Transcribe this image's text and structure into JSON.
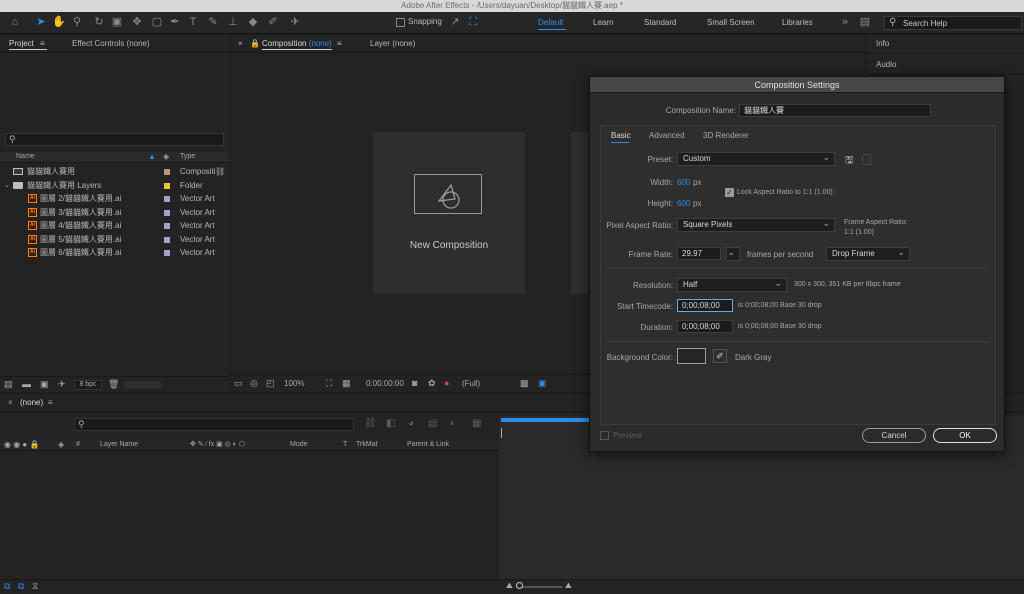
{
  "window": {
    "title": "Adobe After Effects - /Users/dayuan/Desktop/貓貓鐵人賽.aep *"
  },
  "toolbar": {
    "snapping_label": "Snapping",
    "workspaces": [
      "Default",
      "Learn",
      "Standard",
      "Small Screen",
      "Libraries"
    ],
    "active_workspace": "Default",
    "search_placeholder": "Search Help"
  },
  "project_panel": {
    "tabs": [
      "Project",
      "Effect Controls (none)"
    ],
    "columns": {
      "name": "Name",
      "type": "Type"
    },
    "items": [
      {
        "name": "貓貓鐵人賽用",
        "type": "Compositi",
        "icon": "composition-icon",
        "color": "#b89b75",
        "indent": 0
      },
      {
        "name": "貓貓鐵人賽用 Layers",
        "type": "Folder",
        "icon": "folder-icon",
        "color": "#e6c629",
        "indent": 0
      },
      {
        "name": "圖層 2/貓貓鐵人賽用.ai",
        "type": "Vector Art",
        "icon": "ai-file-icon",
        "color": "#a59fd3",
        "indent": 1
      },
      {
        "name": "圖層 3/貓貓鐵人賽用.ai",
        "type": "Vector Art",
        "icon": "ai-file-icon",
        "color": "#a59fd3",
        "indent": 1
      },
      {
        "name": "圖層 4/貓貓鐵人賽用.ai",
        "type": "Vector Art",
        "icon": "ai-file-icon",
        "color": "#a59fd3",
        "indent": 1
      },
      {
        "name": "圖層 5/貓貓鐵人賽用.ai",
        "type": "Vector Art",
        "icon": "ai-file-icon",
        "color": "#a59fd3",
        "indent": 1
      },
      {
        "name": "圖層 6/貓貓鐵人賽用.ai",
        "type": "Vector Art",
        "icon": "ai-file-icon",
        "color": "#a59fd3",
        "indent": 1
      }
    ],
    "bpc_label": "8 bpc"
  },
  "comp_panel": {
    "tab_label": "Composition",
    "tab_value": "(none)",
    "layer_tab": "Layer (none)",
    "new_comp_label": "New Composition",
    "zoom": "100%",
    "timecode": "0:00:00:00",
    "resolution": "(Full)"
  },
  "right_panels": [
    "Info",
    "Audio"
  ],
  "timeline": {
    "tab_label": "(none)",
    "columns": [
      "Layer Name",
      "Mode",
      "T",
      "TrkMat",
      "Parent & Link"
    ]
  },
  "dialog": {
    "title": "Composition Settings",
    "comp_name_label": "Composition Name:",
    "comp_name": "貓貓鐵人賽",
    "tabs": [
      "Basic",
      "Advanced",
      "3D Renderer"
    ],
    "preset_label": "Preset:",
    "preset": "Custom",
    "width_label": "Width:",
    "width": "600",
    "height_label": "Height:",
    "height": "600",
    "px": "px",
    "lock_aspect": "Lock Aspect Ratio to 1:1 (1.00)",
    "par_label": "Pixel Aspect Ratio:",
    "par": "Square Pixels",
    "frame_aspect_label": "Frame Aspect Ratio:",
    "frame_aspect": "1:1 (1.00)",
    "frame_rate_label": "Frame Rate:",
    "frame_rate": "29.97",
    "fps_label": "frames per second",
    "drop_frame": "Drop Frame",
    "resolution_label": "Resolution:",
    "resolution": "Half",
    "resolution_info": "300 x 300, 351 KB per 8bpc frame",
    "start_tc_label": "Start Timecode:",
    "start_tc": "0;00;08;00",
    "start_tc_info": "is 0;00;08;00  Base 30  drop",
    "duration_label": "Duration:",
    "duration": "0;00;08;00",
    "duration_info": "is 0;00;08;00  Base 30  drop",
    "bg_label": "Background Color:",
    "bg_color_name": "Dark Gray",
    "preview_label": "Preview",
    "cancel": "Cancel",
    "ok": "OK"
  },
  "colors": {
    "accent": "#2d8ceb",
    "panel": "#232323",
    "dialog": "#2b2b2b"
  }
}
